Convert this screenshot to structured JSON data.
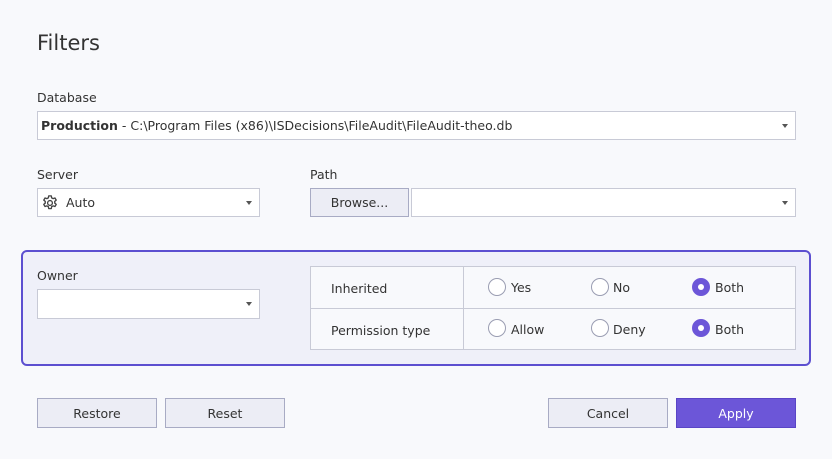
{
  "dialog": {
    "title": "Filters"
  },
  "database": {
    "label": "Database",
    "name": "Production",
    "separator": " - ",
    "path": "C:\\Program Files (x86)\\ISDecisions\\FileAudit\\FileAudit-theo.db"
  },
  "server": {
    "label": "Server",
    "value": "Auto",
    "icon": "gear-icon"
  },
  "path": {
    "label": "Path",
    "browse_label": "Browse...",
    "value": ""
  },
  "owner": {
    "label": "Owner",
    "value": ""
  },
  "inherited": {
    "label": "Inherited",
    "options": [
      "Yes",
      "No",
      "Both"
    ],
    "selected": "Both"
  },
  "permission_type": {
    "label": "Permission type",
    "options": [
      "Allow",
      "Deny",
      "Both"
    ],
    "selected": "Both"
  },
  "buttons": {
    "restore": "Restore",
    "reset": "Reset",
    "cancel": "Cancel",
    "apply": "Apply"
  },
  "colors": {
    "accent": "#6c56d8",
    "panel_border": "#5c4fd0",
    "panel_bg": "#eff0f9"
  }
}
